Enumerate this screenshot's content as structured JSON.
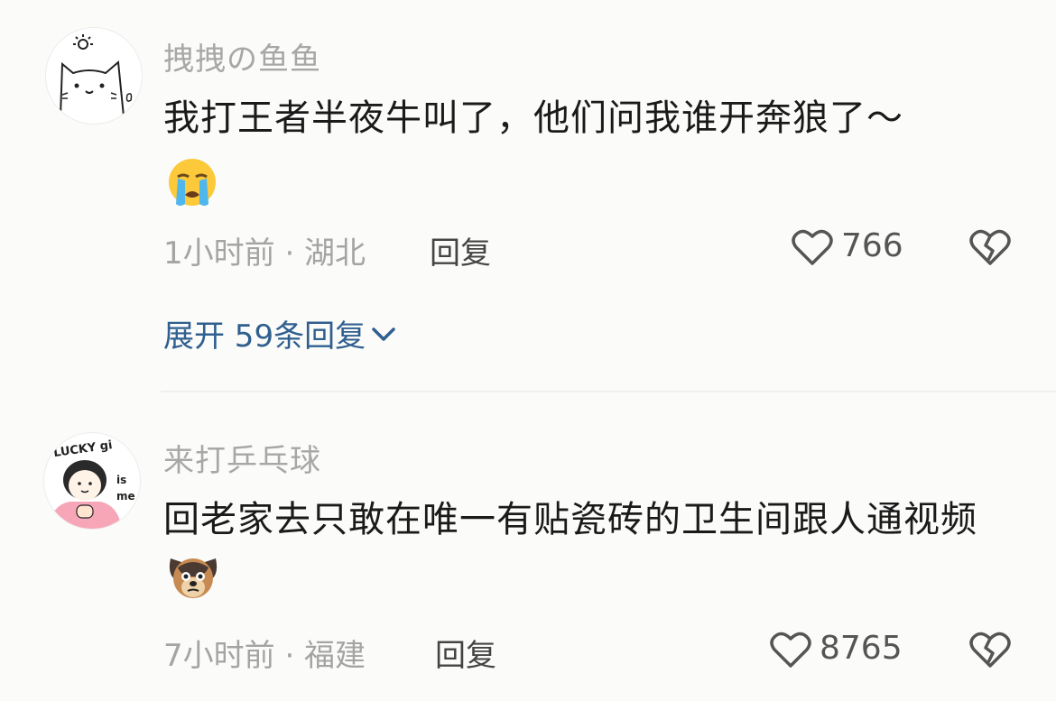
{
  "comments": [
    {
      "username": "拽拽の鱼鱼",
      "text": "我打王者半夜牛叫了，他们问我谁开奔狼了～",
      "emoji": "loudly-crying-face-icon",
      "time_location": "1小时前 · 湖北",
      "reply_label": "回复",
      "likes": "766",
      "expand_label": "展开 59条回复"
    },
    {
      "username": "来打乒乓球",
      "text": "回老家去只敢在唯一有贴瓷砖的卫生间跟人通视频",
      "emoji": "puppy-face-icon",
      "avatar_lettering": "LUCKY girl is me",
      "time_location": "7小时前 · 福建",
      "reply_label": "回复",
      "likes": "8765"
    }
  ],
  "colors": {
    "background": "#fbfbf9",
    "username": "#a7a7a7",
    "text": "#1a1a1a",
    "meta": "#a4a4a4",
    "link": "#2f5f8f"
  }
}
